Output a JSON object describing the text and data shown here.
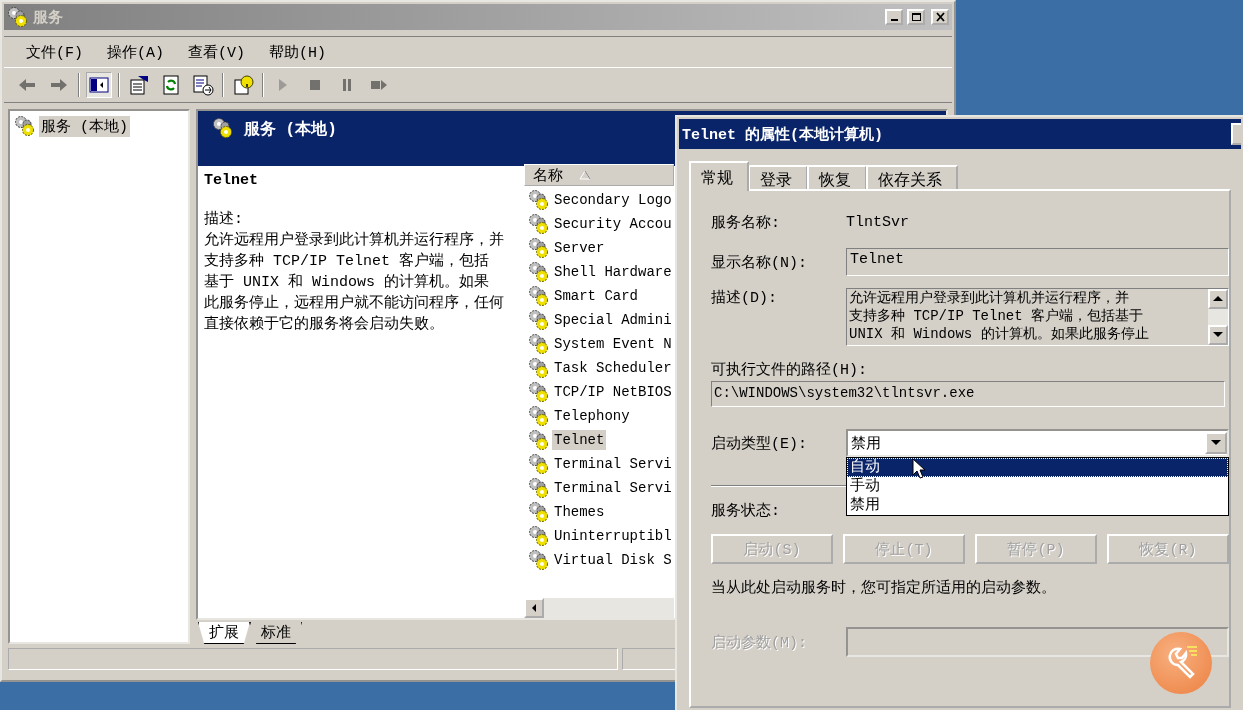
{
  "main_window": {
    "title": "服务",
    "menu": [
      "文件(F)",
      "操作(A)",
      "查看(V)",
      "帮助(H)"
    ],
    "toolbar": [
      {
        "kind": "back",
        "disabled": true,
        "pressed": false
      },
      {
        "kind": "forward",
        "disabled": true,
        "pressed": false
      },
      {
        "kind": "separator"
      },
      {
        "kind": "tree-toggle",
        "disabled": false,
        "pressed": true
      },
      {
        "kind": "separator"
      },
      {
        "kind": "properties",
        "disabled": false,
        "pressed": false
      },
      {
        "kind": "refresh",
        "disabled": false,
        "pressed": false
      },
      {
        "kind": "export",
        "disabled": false,
        "pressed": false
      },
      {
        "kind": "separator"
      },
      {
        "kind": "help",
        "disabled": false,
        "pressed": false
      },
      {
        "kind": "separator"
      },
      {
        "kind": "start",
        "disabled": true,
        "pressed": false
      },
      {
        "kind": "stop",
        "disabled": true,
        "pressed": false
      },
      {
        "kind": "pause",
        "disabled": true,
        "pressed": false
      },
      {
        "kind": "restart",
        "disabled": true,
        "pressed": false
      }
    ],
    "tree": [
      {
        "label": "服务 (本地)",
        "selected": true
      }
    ],
    "panel": {
      "title": "服务 (本地)",
      "service_name": "Telnet",
      "description_label": "描述:",
      "description": "允许远程用户登录到此计算机并运行程序，并支持多种 TCP/IP Telnet 客户端，包括基于 UNIX 和 Windows 的计算机。如果此服务停止，远程用户就不能访问程序，任何直接依赖于它的服务将会启动失败。"
    },
    "list": {
      "column": "名称",
      "rows": [
        {
          "name": "Secondary Logo",
          "selected": false
        },
        {
          "name": "Security Accou",
          "selected": false
        },
        {
          "name": "Server",
          "selected": false
        },
        {
          "name": "Shell Hardware",
          "selected": false
        },
        {
          "name": "Smart Card",
          "selected": false
        },
        {
          "name": "Special Admini",
          "selected": false
        },
        {
          "name": "System Event N",
          "selected": false
        },
        {
          "name": "Task Scheduler",
          "selected": false
        },
        {
          "name": "TCP/IP NetBIOS",
          "selected": false
        },
        {
          "name": "Telephony",
          "selected": false
        },
        {
          "name": "Telnet",
          "selected": true
        },
        {
          "name": "Terminal Servi",
          "selected": false
        },
        {
          "name": "Terminal Servi",
          "selected": false
        },
        {
          "name": "Themes",
          "selected": false
        },
        {
          "name": "Uninterruptibl",
          "selected": false
        },
        {
          "name": "Virtual Disk S",
          "selected": false
        }
      ]
    },
    "view_tabs": [
      {
        "label": "扩展",
        "selected": true
      },
      {
        "label": "标准",
        "selected": false
      }
    ]
  },
  "dialog": {
    "title": "Telnet 的属性(本地计算机)",
    "tabs": [
      {
        "label": "常规",
        "selected": true
      },
      {
        "label": "登录",
        "selected": false
      },
      {
        "label": "恢复",
        "selected": false
      },
      {
        "label": "依存关系",
        "selected": false
      }
    ],
    "service_name_label": "服务名称:",
    "service_name": "TlntSvr",
    "display_name_label": "显示名称(N):",
    "display_name": "Telnet",
    "description_label": "描述(D):",
    "description_lines": [
      "允许远程用户登录到此计算机并运行程序，并",
      "支持多种 TCP/IP Telnet 客户端，包括基于",
      "UNIX 和 Windows 的计算机。如果此服务停止"
    ],
    "path_label": "可执行文件的路径(H):",
    "path": "C:\\WINDOWS\\system32\\tlntsvr.exe",
    "startup_label": "启动类型(E):",
    "startup_value": "禁用",
    "startup_expanded": true,
    "startup_options": [
      {
        "label": "自动",
        "selected": true
      },
      {
        "label": "手动",
        "selected": false
      },
      {
        "label": "禁用",
        "selected": false
      }
    ],
    "status_label": "服务状态:",
    "buttons": [
      {
        "label": "启动(S)",
        "disabled": true
      },
      {
        "label": "停止(T)",
        "disabled": true
      },
      {
        "label": "暂停(P)",
        "disabled": true
      },
      {
        "label": "恢复(R)",
        "disabled": true
      }
    ],
    "hint": "当从此处启动服务时，您可指定所适用的启动参数。",
    "param_label": "启动参数(M):",
    "param_disabled": true
  }
}
